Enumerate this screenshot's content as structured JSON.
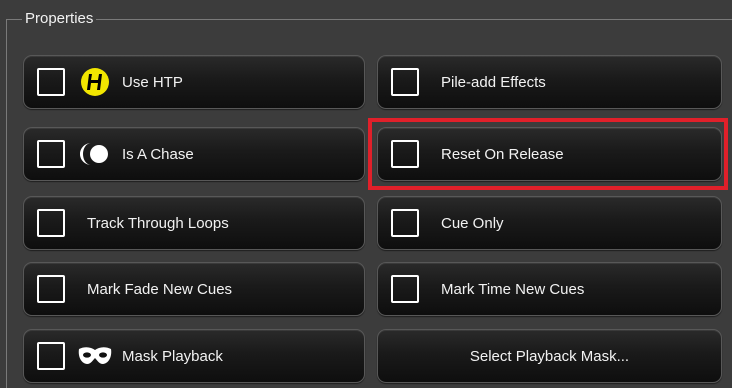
{
  "group": {
    "title": "Properties"
  },
  "buttons": {
    "use_htp": {
      "label": "Use HTP",
      "icon": "htp-icon"
    },
    "pile_add_effects": {
      "label": "Pile-add Effects"
    },
    "is_a_chase": {
      "label": "Is A Chase",
      "icon": "chase-icon"
    },
    "reset_on_release": {
      "label": "Reset On Release"
    },
    "track_through_loops": {
      "label": "Track Through Loops"
    },
    "cue_only": {
      "label": "Cue Only"
    },
    "mark_fade_new_cues": {
      "label": "Mark Fade New Cues"
    },
    "mark_time_new_cues": {
      "label": "Mark Time New Cues"
    },
    "mask_playback": {
      "label": "Mask Playback",
      "icon": "mask-icon"
    },
    "select_playback_mask": {
      "label": "Select Playback Mask..."
    }
  },
  "colors": {
    "highlight": "#e0202a",
    "htp_badge": "#f2e600"
  }
}
